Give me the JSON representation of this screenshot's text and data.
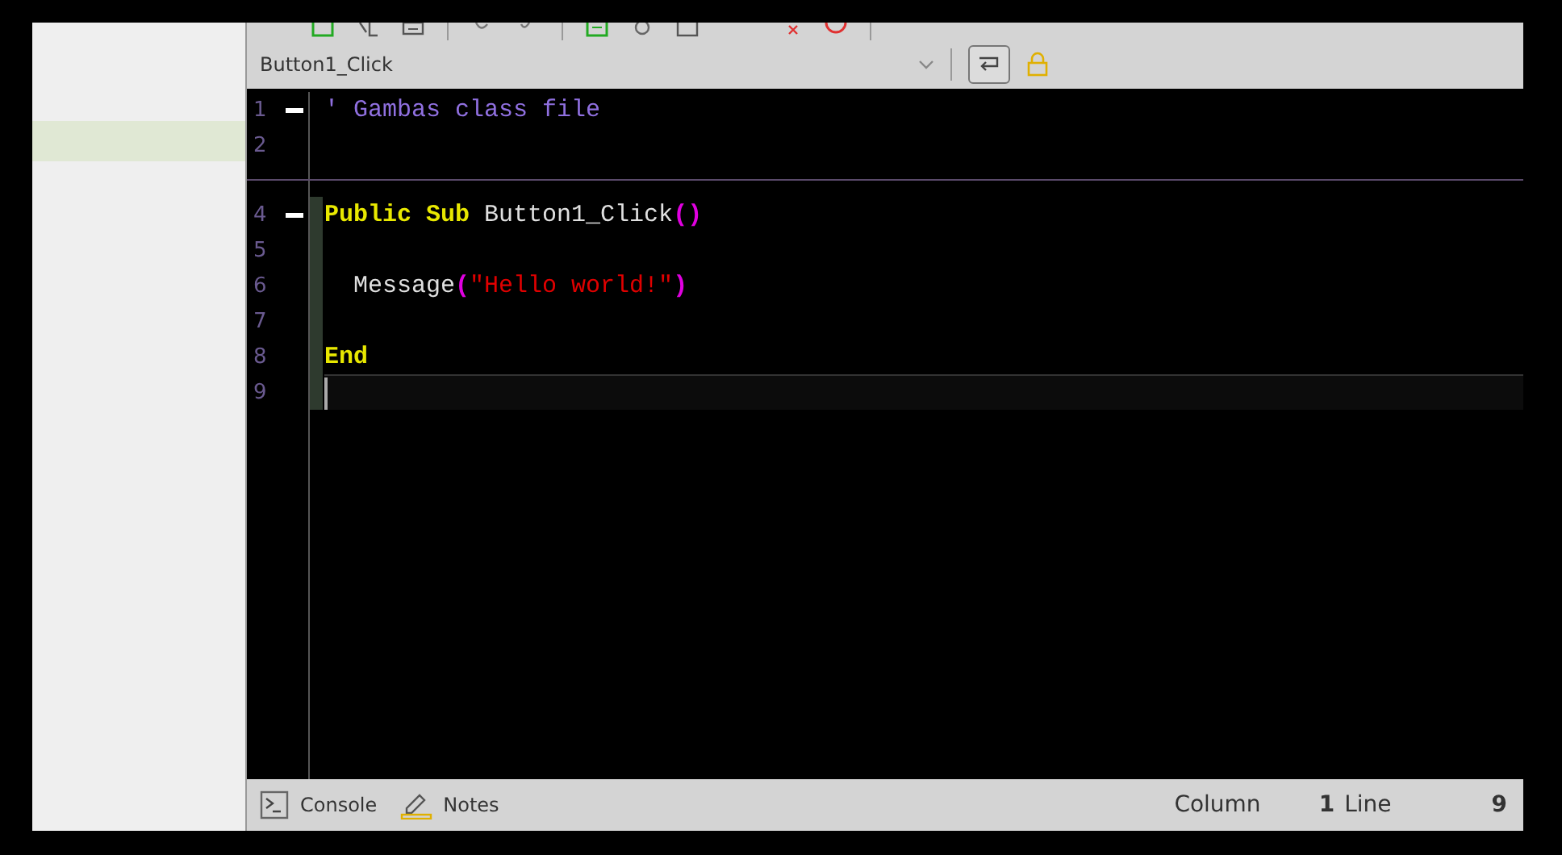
{
  "procedure_bar": {
    "value": "Button1_Click",
    "wrap_on": true,
    "locked": true
  },
  "editor": {
    "lines": [
      {
        "kind": "code",
        "number": "1",
        "fold": true,
        "modified": false,
        "current": false,
        "tokens": [
          {
            "kind": "comment",
            "text": "' Gambas class file"
          }
        ]
      },
      {
        "kind": "code",
        "number": "2",
        "fold": false,
        "modified": false,
        "current": false
      },
      {
        "kind": "separator"
      },
      {
        "kind": "code",
        "number": "4",
        "fold": true,
        "modified": true,
        "current": false,
        "tokens": [
          {
            "kind": "keyword",
            "text": "Public"
          },
          {
            "kind": "keyword",
            "text": " Sub"
          },
          {
            "kind": "ident",
            "text": " Button1_Click"
          },
          {
            "kind": "paren",
            "text": "()"
          }
        ]
      },
      {
        "kind": "code",
        "number": "5",
        "fold": false,
        "modified": true,
        "current": false
      },
      {
        "kind": "code",
        "number": "6",
        "fold": false,
        "modified": true,
        "current": false,
        "tokens": [
          {
            "kind": "ident",
            "text": "  Message"
          },
          {
            "kind": "paren",
            "text": "("
          },
          {
            "kind": "string",
            "text": "\"Hello world!\""
          },
          {
            "kind": "paren",
            "text": ")"
          }
        ]
      },
      {
        "kind": "code",
        "number": "7",
        "fold": false,
        "modified": true,
        "current": false
      },
      {
        "kind": "code",
        "number": "8",
        "fold": false,
        "modified": true,
        "current": false,
        "tokens": [
          {
            "kind": "keyword",
            "text": "End"
          }
        ]
      },
      {
        "kind": "code",
        "number": "9",
        "fold": false,
        "modified": true,
        "current": true
      }
    ]
  },
  "status_bar": {
    "console": "Console",
    "notes": "Notes",
    "column_label": "Column",
    "column": "1",
    "line_label": "Line",
    "line": "9"
  }
}
